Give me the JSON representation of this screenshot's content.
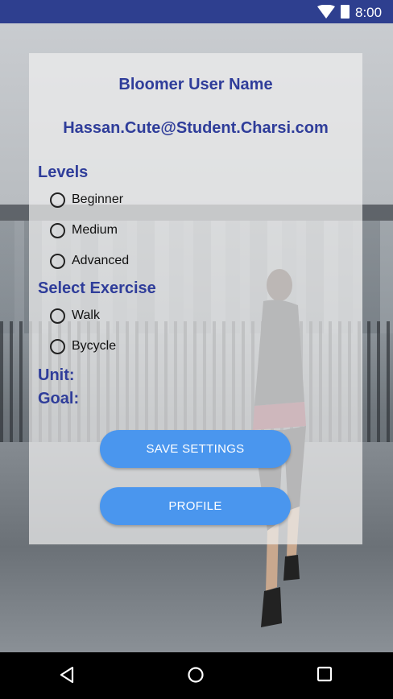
{
  "status_bar": {
    "time": "8:00",
    "icons": [
      "wifi-icon",
      "battery-icon"
    ],
    "background": "#2e3f8f"
  },
  "card": {
    "user_name": "Bloomer User Name",
    "email": "Hassan.Cute@Student.Charsi.com",
    "levels": {
      "label": "Levels",
      "options": [
        "Beginner",
        "Medium",
        "Advanced"
      ]
    },
    "exercise": {
      "label": "Select Exercise",
      "options": [
        "Walk",
        "Bycycle"
      ]
    },
    "unit_label": "Unit:",
    "goal_label": "Goal:",
    "save_button": "SAVE SETTINGS",
    "profile_button": "PROFILE",
    "accent_color": "#2f3d9a",
    "button_color": "#4a96ee"
  },
  "nav_bar": {
    "icons": [
      "back-icon",
      "home-icon",
      "recents-icon"
    ]
  }
}
